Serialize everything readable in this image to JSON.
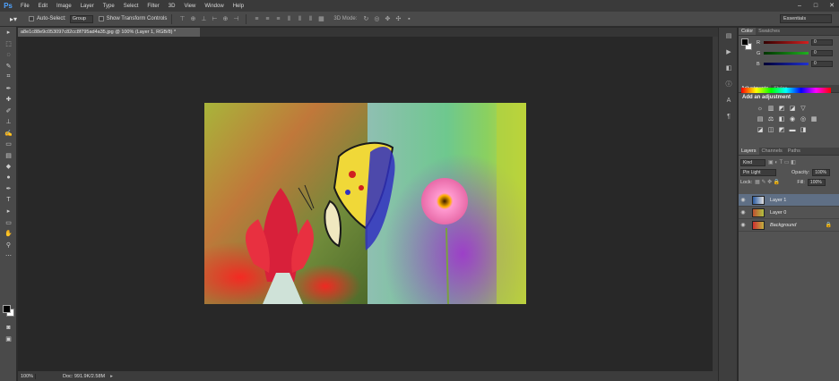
{
  "app": {
    "logo": "Ps",
    "menu": [
      "File",
      "Edit",
      "Image",
      "Layer",
      "Type",
      "Select",
      "Filter",
      "3D",
      "View",
      "Window",
      "Help"
    ],
    "window_controls": [
      "–",
      "□",
      "✕"
    ]
  },
  "options_bar": {
    "auto_select_label": "Auto-Select:",
    "auto_select_value": "Group",
    "show_transform_label": "Show Transform Controls",
    "mode_3d_label": "3D Mode:",
    "workspace": "Essentials"
  },
  "document": {
    "tab_title": "a8e1c88e9c053097c82cc8f795ad4a35.jpg @ 100% (Layer 1, RGB/8) *",
    "zoom": "100%",
    "doc_info": "Doc: 991.9K/2.58M"
  },
  "color_panel": {
    "tabs": [
      "Color",
      "Swatches"
    ],
    "channels": [
      {
        "label": "R",
        "value": "0",
        "color": "#d32020"
      },
      {
        "label": "G",
        "value": "0",
        "color": "#20b020"
      },
      {
        "label": "B",
        "value": "0",
        "color": "#2030d0"
      }
    ]
  },
  "adjustments_panel": {
    "tabs": [
      "Adjustments",
      "Styles"
    ],
    "title": "Add an adjustment"
  },
  "layers_panel": {
    "tabs": [
      "Layers",
      "Channels",
      "Paths"
    ],
    "kind": "Kind",
    "blend_mode": "Pin Light",
    "opacity_label": "Opacity:",
    "opacity_value": "100%",
    "lock_label": "Lock:",
    "fill_label": "Fill:",
    "fill_value": "100%",
    "layers": [
      {
        "name": "Layer 1",
        "active": true
      },
      {
        "name": "Layer 0",
        "active": false
      },
      {
        "name": "Background",
        "active": false,
        "locked": true
      }
    ]
  }
}
